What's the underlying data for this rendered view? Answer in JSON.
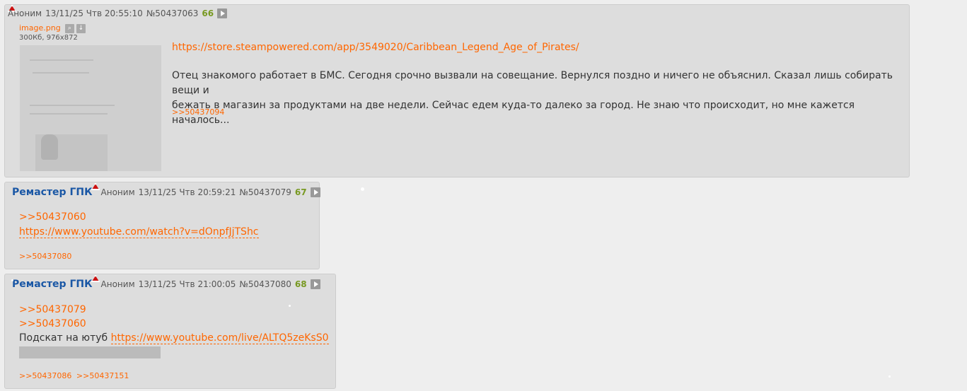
{
  "posts": [
    {
      "name": "Аноним",
      "date": "13/11/25 Чтв 20:55:10",
      "num": "№50437063",
      "count": "66",
      "file": {
        "name": "image.png",
        "meta": "300Кб, 976x872"
      },
      "link": "https://store.steampowered.com/app/3549020/Caribbean_Legend_Age_of_Pirates/",
      "text_line1": "Отец знакомого работает в БМС. Сегодня срочно вызвали на совещание. Вернулся поздно и ничего не объяснил. Сказал лишь собирать вещи и",
      "text_line2": "бежать в магазин за продуктами на две недели. Сейчас едем куда-то далеко за город. Не знаю что происходит, но мне кажется началось...",
      "replies": [
        ">>50437094"
      ]
    },
    {
      "username": "Ремастер ГПК",
      "name": "Аноним",
      "date": "13/11/25 Чтв 20:59:21",
      "num": "№50437079",
      "count": "67",
      "refs": [
        ">>50437060"
      ],
      "link": "https://www.youtube.com/watch?v=dOnpfJjTShc",
      "replies": [
        ">>50437080"
      ]
    },
    {
      "username": "Ремастер ГПК",
      "name": "Аноним",
      "date": "13/11/25 Чтв 21:00:05",
      "num": "№50437080",
      "count": "68",
      "refs": [
        ">>50437079",
        ">>50437060"
      ],
      "text_prefix": "Подскат на ютуб",
      "link": "https://www.youtube.com/live/ALTQ5zeKsS0",
      "replies": [
        ">>50437086",
        ">>50437151"
      ]
    }
  ]
}
